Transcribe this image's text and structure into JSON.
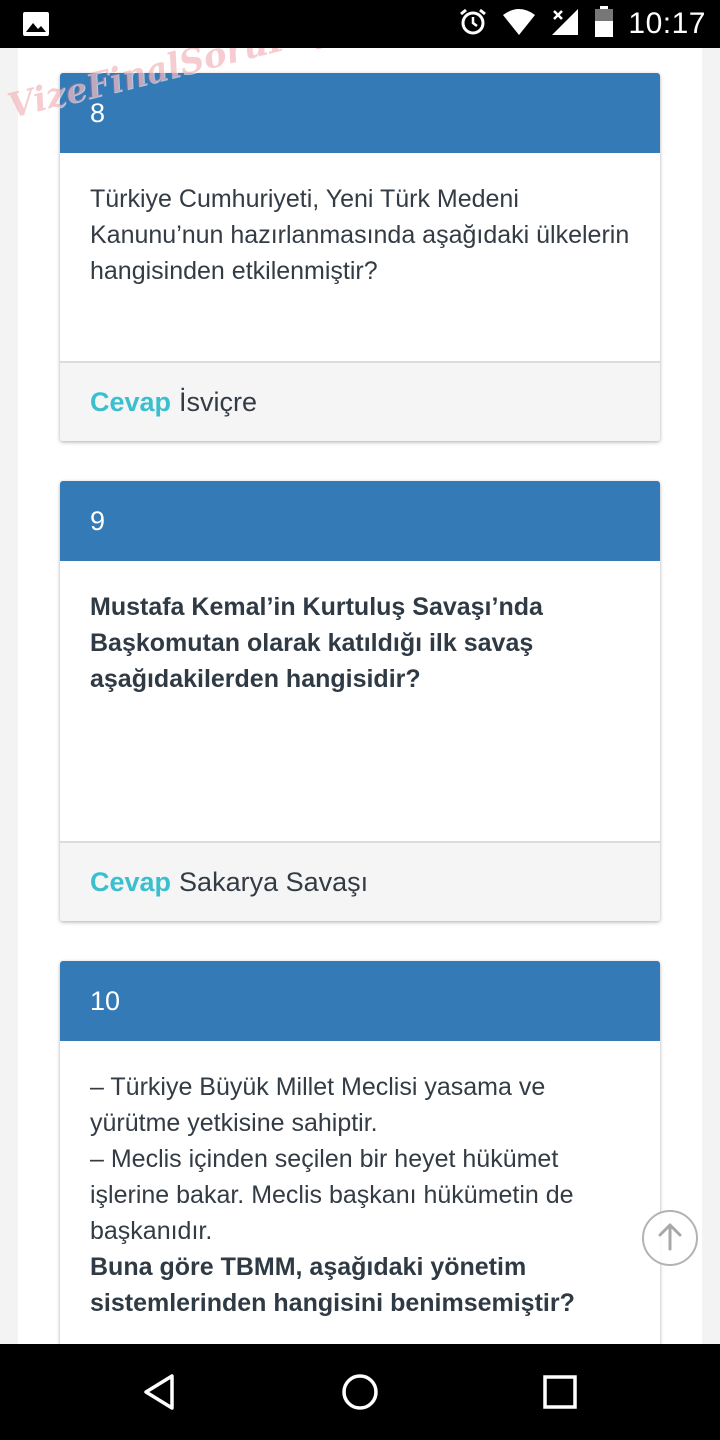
{
  "status_bar": {
    "time": "10:17",
    "icons": [
      "image-icon",
      "alarm-icon",
      "wifi-icon",
      "signal-icon",
      "battery-icon"
    ]
  },
  "watermark": {
    "text": "VizeFinalSoruPaylasimi.com"
  },
  "cards": [
    {
      "number": "8",
      "question": "Türkiye Cumhuriyeti, Yeni Türk Medeni Kanunu’nun hazırlanmasında aşağıdaki ülkelerin hangisinden etkilenmiştir?",
      "answer_label": "Cevap",
      "answer": "İsviçre"
    },
    {
      "number": "9",
      "question": "Mustafa Kemal’in Kurtuluş Savaşı’nda Başkomutan olarak katıldığı ilk savaş aşağıdakilerden hangisidir?",
      "answer_label": "Cevap",
      "answer": "Sakarya Savaşı"
    },
    {
      "number": "10",
      "lines": [
        "– Türkiye Büyük Millet Meclisi yasama ve yürütme yetkisine sahiptir.",
        "– Meclis içinden seçilen bir heyet hükümet işlerine bakar. Meclis başkanı hükümetin de başkanıdır."
      ],
      "question": "Buna göre TBMM, aşağıdaki yönetim sistemlerinden hangisini benimsemiştir?"
    }
  ],
  "scroll_top": {
    "icon": "arrow-up-icon"
  },
  "nav_bar": {
    "icons": [
      "back-icon",
      "home-icon",
      "recents-icon"
    ]
  },
  "colors": {
    "header_blue": "#337ab7",
    "cevap_teal": "#3bbfcf",
    "footer_gray": "#f5f5f5"
  }
}
